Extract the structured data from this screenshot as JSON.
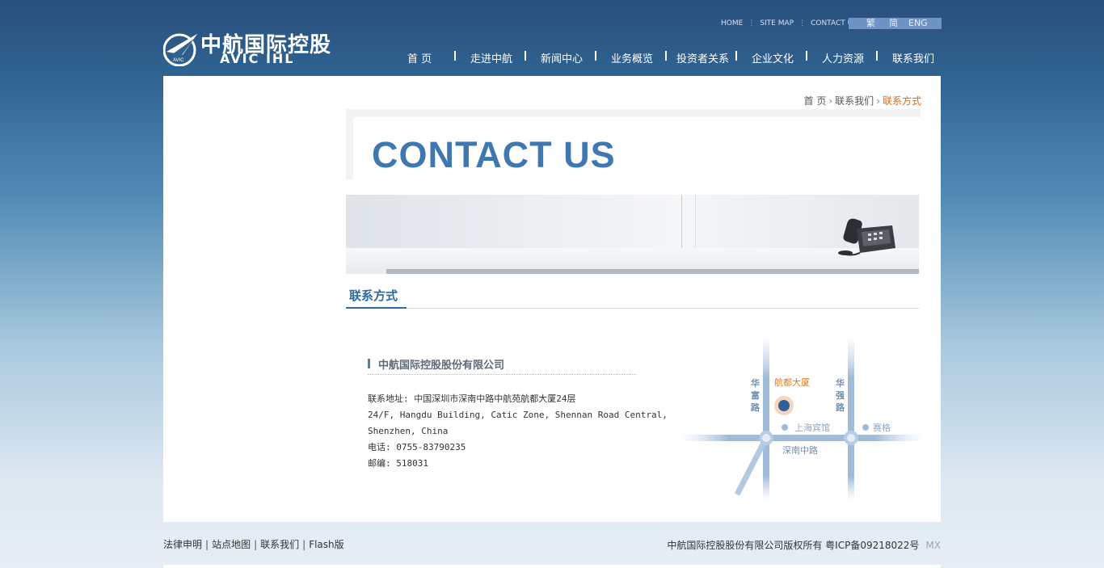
{
  "header": {
    "logo_cn": "中航国际控股",
    "logo_en": "AVIC IHL",
    "logo_mark_text": "AVIC",
    "toplinks": [
      "HOME",
      "SITE MAP",
      "CONTACT US"
    ],
    "toplinks_sep": "⋮",
    "lang": [
      "繁",
      "简",
      "ENG"
    ],
    "nav": [
      "首 页",
      "走进中航",
      "新闻中心",
      "业务概览",
      "投资者关系",
      "企业文化",
      "人力资源",
      "联系我们"
    ]
  },
  "breadcrumb": {
    "items": [
      "首 页",
      "联系我们"
    ],
    "arrow": "›",
    "current": "联系方式"
  },
  "banner": {
    "title": "CONTACT US"
  },
  "section": {
    "title": "联系方式"
  },
  "contact": {
    "company": "中航国际控股股份有限公司",
    "address_cn": "联系地址: 中国深圳市深南中路中航苑航都大厦24层",
    "address_en_1": "24/F, Hangdu Building, Catic Zone, Shennan Road Central,",
    "address_en_2": "Shenzhen, China",
    "phone": "电话: 0755-83790235",
    "postcode": "邮编: 518031"
  },
  "map": {
    "road_left": [
      "华",
      "富",
      "路"
    ],
    "road_right": [
      "华",
      "强",
      "路"
    ],
    "building": "航都大厦",
    "hotel": "上海宾馆",
    "saige": "赛格",
    "main_road": "深南中路"
  },
  "footer": {
    "links": [
      "法律申明",
      "站点地图",
      "联系我们",
      "Flash版"
    ],
    "sep": "|",
    "copyright": "中航国际控股股份有限公司版权所有 粤ICP备09218022号",
    "mx": "MX"
  },
  "colors": {
    "accent": "#2d6a9f",
    "breadcrumb_current": "#d96a10",
    "building_label": "#e07b12"
  }
}
